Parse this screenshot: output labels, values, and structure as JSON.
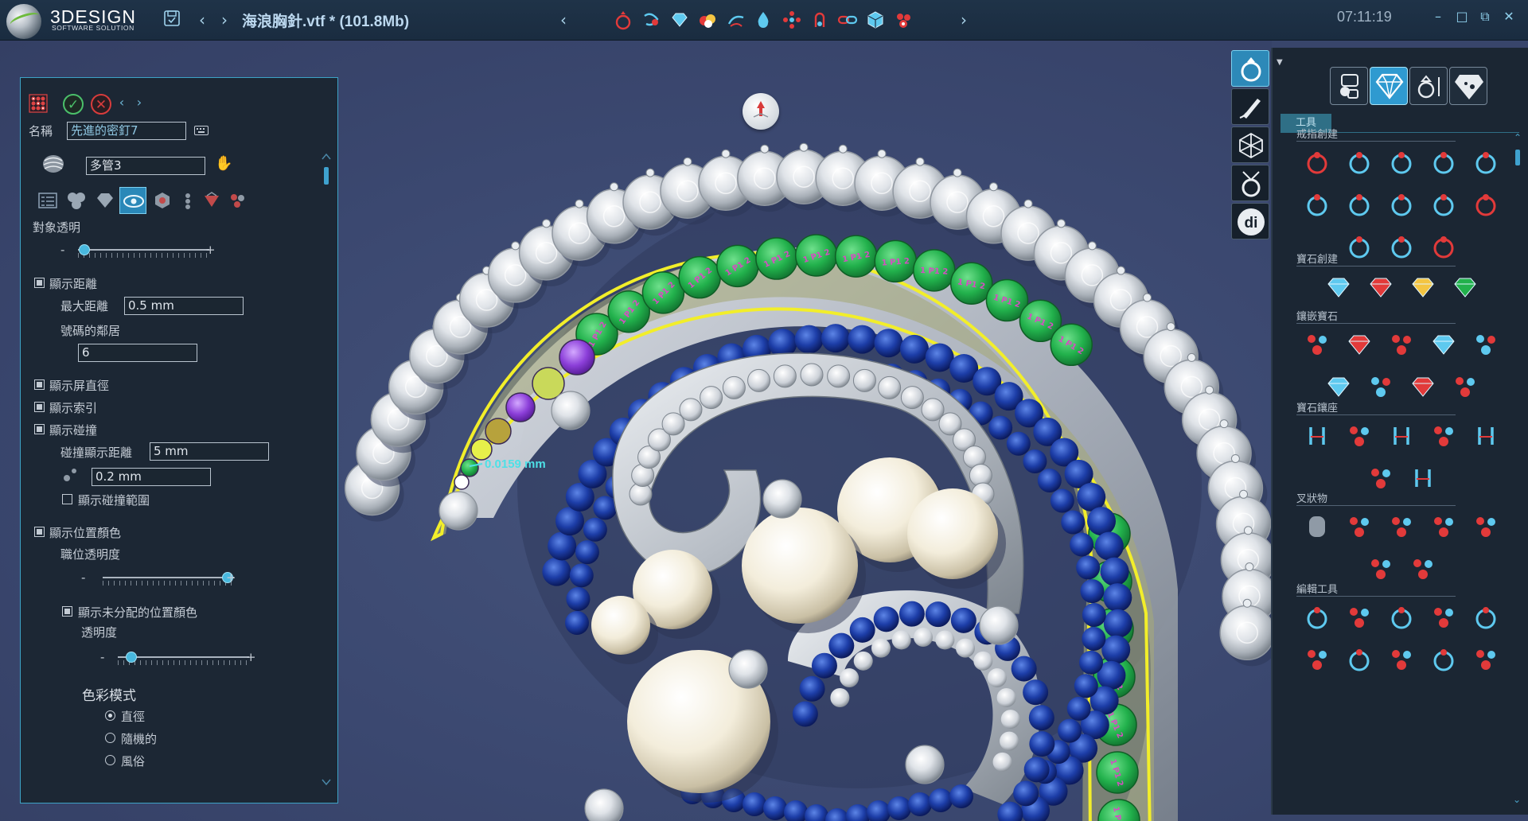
{
  "app": {
    "logo_text": "3DESIGN",
    "logo_subtitle": "SOFTWARE SOLUTION",
    "file_title": "海浪胸針.vtf * (101.8Mb)",
    "clock": "07:11:19"
  },
  "toolbar": {
    "icons": [
      "save-icon",
      "back-arrow-icon",
      "forward-arrow-icon",
      "scroll-left-icon",
      "ring-create-icon",
      "shank-icon",
      "gem-icon",
      "colored-gems-icon",
      "rope-icon",
      "drop-icon",
      "cluster-icon",
      "bail-icon",
      "link-icon",
      "cube-icon",
      "pave-icon",
      "scroll-right-icon"
    ]
  },
  "viewport": {
    "measure_label": "0.0159 mm",
    "colors": {
      "background": "#3b4870",
      "metal": "#c9cdd3",
      "sapphire": "#1d3ea8",
      "gem_highlight": "#22b14c",
      "outline": "#f2ee2a",
      "purple_gem": "#8c3fd9"
    },
    "gem_numbers": [
      "1 P1 2",
      "1 P1 2",
      "1 P1 2",
      "1 P1 2",
      "1 P1 2",
      "1 P1 2"
    ]
  },
  "left_panel": {
    "name_label": "名稱",
    "name_value": "先進的密釘7",
    "object_value": "多管3",
    "transparency_label": "對象透明",
    "transparency_value": 0.05,
    "show_distance_label": "顯示距離",
    "max_distance_label": "最大距離",
    "max_distance_value": "0.5 mm",
    "neighbors_label": "號碼的鄰居",
    "neighbors_value": "6",
    "show_screen_diameter_label": "顯示屏直徑",
    "show_index_label": "顯示索引",
    "show_collision_label": "顯示碰撞",
    "collision_distance_label": "碰撞顯示距離",
    "collision_distance_value": "5 mm",
    "collision_step_value": "0.2 mm",
    "show_collision_range_label": "顯示碰撞範圍",
    "show_position_color_label": "顯示位置顏色",
    "position_transparency_label": "職位透明度",
    "position_transparency_value": 0.95,
    "show_unassigned_label": "顯示未分配的位置顏色",
    "transparency2_label": "透明度",
    "transparency2_value": 0.1,
    "color_mode_label": "色彩模式",
    "color_modes": [
      "直徑",
      "隨機的",
      "風俗"
    ],
    "selected_color_mode": "直徑",
    "minus": "-",
    "plus": "+"
  },
  "right_panel": {
    "tab_label": "工具",
    "sections": [
      {
        "title": "戒指創建",
        "icons": [
          "solitaire-ring-icon",
          "crown-ring-icon",
          "band-ring-icon",
          "split-shank-icon",
          "twist-ring-icon",
          "signet-ring-icon",
          "wide-band-icon",
          "spiral-ring-icon",
          "braided-ring-icon",
          "eternity-ring-icon",
          "bypass-ring-icon",
          "halo-ring-icon",
          "thin-band-icon"
        ]
      },
      {
        "title": "寶石創建",
        "icons": [
          "round-gem-icon",
          "red-gem-icon",
          "star-gem-icon",
          "multi-gem-icon"
        ]
      },
      {
        "title": "鑲嵌寶石",
        "icons": [
          "scatter-gems-icon",
          "single-setting-icon",
          "drop-setting-icon",
          "pave-line-icon",
          "channel-icon",
          "gem-trail-icon",
          "flower-icon",
          "grid-gems-icon",
          "cluster-gems-icon"
        ]
      },
      {
        "title": "寶石鑲座",
        "icons": [
          "prong-head-icon",
          "basket-head-icon",
          "bezel-icon",
          "shared-prong-icon",
          "triple-setting-icon",
          "halo-setting-icon",
          "ring-head-icon"
        ]
      },
      {
        "title": "叉狀物",
        "icons": [
          "bead-icon",
          "prong-dots-icon",
          "prong-cluster-icon",
          "tray-icon",
          "cross-prong-icon",
          "ring-prong-icon",
          "ring-prong-2-icon"
        ]
      },
      {
        "title": "編輯工具",
        "icons": [
          "setting-edit-icon",
          "ring-edit-icon",
          "arc-icon",
          "reshape-icon",
          "dotted-ring-icon",
          "red-ball-icon",
          "horn-icon",
          "heart-icon",
          "wire-icon",
          "hook-icon"
        ]
      }
    ]
  },
  "side_buttons": [
    "ring-mode-icon",
    "draw-mode-icon",
    "mesh-mode-icon",
    "jewelry-mode-icon",
    "di-mode-icon"
  ]
}
